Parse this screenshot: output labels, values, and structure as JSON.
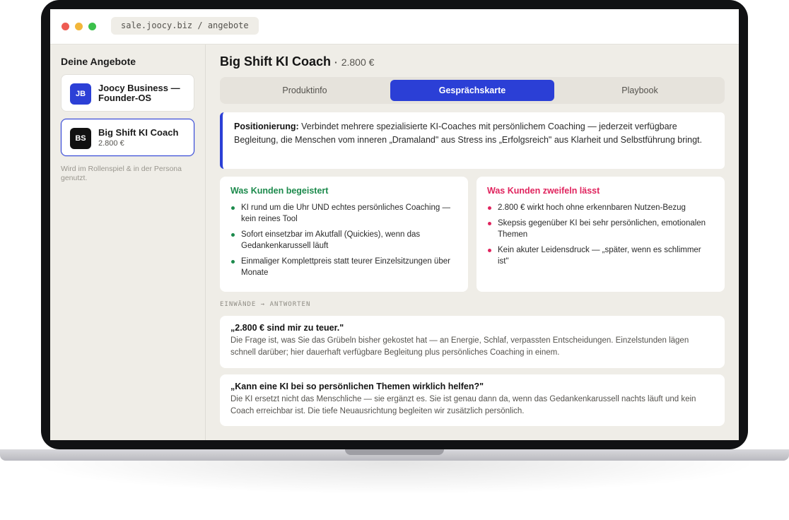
{
  "browser": {
    "url": "sale.joocy.biz / angebote"
  },
  "sidebar": {
    "title": "Deine Angebote",
    "offers": [
      {
        "initials": "JB",
        "name": "Joocy Business — Founder-OS",
        "price": ""
      },
      {
        "initials": "BS",
        "name": "Big Shift KI Coach",
        "price": "2.800 €"
      }
    ],
    "note": "Wird im Rollenspiel & in der Persona genutzt."
  },
  "main": {
    "title": "Big Shift KI Coach",
    "separator": "·",
    "price": "2.800 €",
    "tabs": [
      {
        "label": "Produktinfo"
      },
      {
        "label": "Gesprächskarte"
      },
      {
        "label": "Playbook"
      }
    ],
    "active_tab": "Gesprächskarte",
    "positioning": {
      "label": "Positionierung:",
      "text": "Verbindet mehrere spezialisierte KI-Coaches mit persönlichem Coaching — jederzeit verfügbare Begleitung, die Menschen vom inneren „Dramaland\" aus Stress ins „Erfolgsreich\" aus Klarheit und Selbstführung bringt."
    },
    "pros": {
      "title": "Was Kunden begeistert",
      "items": [
        "KI rund um die Uhr UND echtes persönliches Coaching — kein reines Tool",
        "Sofort einsetzbar im Akutfall (Quickies), wenn das Gedankenkarussell läuft",
        "Einmaliger Komplettpreis statt teurer Einzelsitzungen über Monate"
      ]
    },
    "cons": {
      "title": "Was Kunden zweifeln lässt",
      "items": [
        "2.800 € wirkt hoch ohne erkennbaren Nutzen-Bezug",
        "Skepsis gegenüber KI bei sehr persönlichen, emotionalen Themen",
        "Kein akuter Leidensdruck — „später, wenn es schlimmer ist\""
      ]
    },
    "objections_label": "EINWÄNDE → ANTWORTEN",
    "objections": [
      {
        "q": "„2.800 € sind mir zu teuer.\"",
        "a": "Die Frage ist, was Sie das Grübeln bisher gekostet hat — an Energie, Schlaf, verpassten Entscheidungen. Einzelstunden lägen schnell darüber; hier dauerhaft verfügbare Begleitung plus persönliches Coaching in einem."
      },
      {
        "q": "„Kann eine KI bei so persönlichen Themen wirklich helfen?\"",
        "a": "Die KI ersetzt nicht das Menschliche — sie ergänzt es. Sie ist genau dann da, wenn das Gedankenkarussell nachts läuft und kein Coach erreichbar ist. Die tiefe Neuausrichtung begleiten wir zusätzlich persönlich."
      }
    ]
  },
  "colors": {
    "accent": "#2b3fd6",
    "positive": "#1c8a4c",
    "negative": "#e0245e",
    "background": "#efede7"
  }
}
